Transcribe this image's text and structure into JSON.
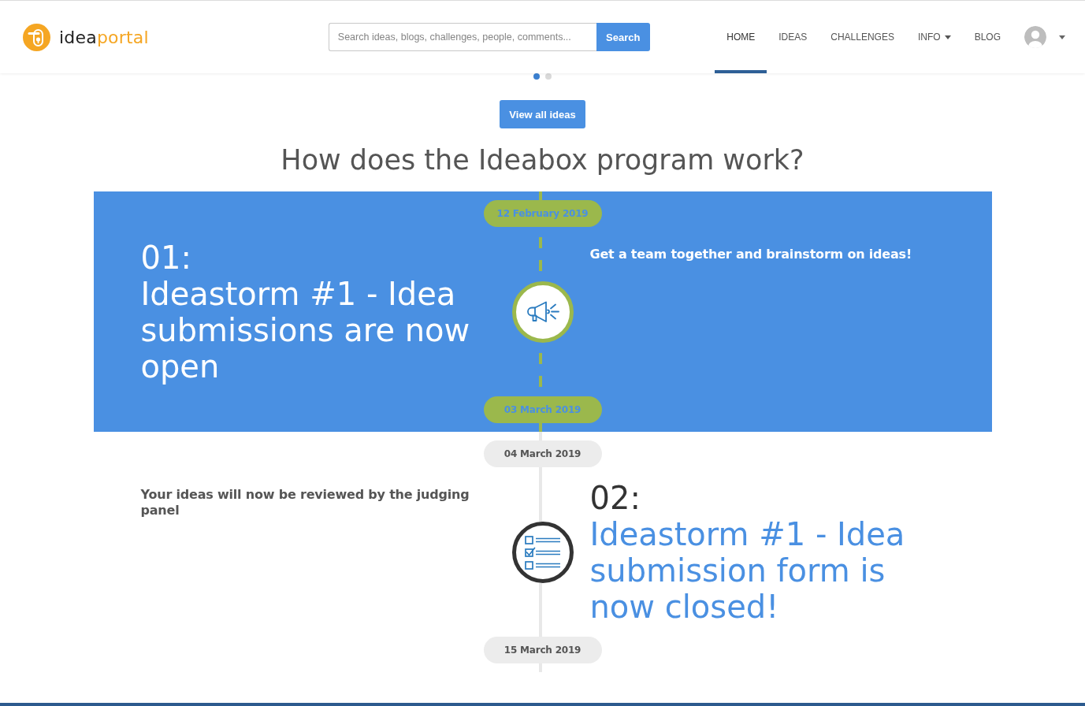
{
  "header": {
    "logo": {
      "parts": [
        {
          "text": "idea",
          "color": "#222222"
        },
        {
          "text": "portal",
          "color": "#f5a623"
        }
      ]
    },
    "search": {
      "placeholder": "Search ideas, blogs, challenges, people, comments...",
      "button": "Search"
    },
    "nav": [
      {
        "label": "HOME",
        "kind": "link",
        "selected": true
      },
      {
        "label": "IDEAS",
        "kind": "link",
        "selected": false
      },
      {
        "label": "CHALLENGES",
        "kind": "link",
        "selected": false
      },
      {
        "label": "INFO",
        "kind": "dropdown",
        "selected": false
      },
      {
        "label": "BLOG",
        "kind": "link",
        "selected": false
      }
    ]
  },
  "carousel": {
    "dots": [
      {
        "selected": true
      },
      {
        "selected": false
      }
    ]
  },
  "view_all_button": "View all ideas",
  "section_title": "How does the Ideabox program work?",
  "timeline": [
    {
      "kind": "submission",
      "active": true,
      "start_date": "12 February 2019",
      "end_date": "03 March 2019",
      "number": "01:",
      "title": "Ideastorm #1 - Idea submissions are now open",
      "description": "Get a team together and brainstorm on ideas!"
    },
    {
      "kind": "review",
      "active": false,
      "start_date": "04 March 2019",
      "end_date": "15 March 2019",
      "number": "02:",
      "title": "Ideastorm #1 - Idea submission form is now closed!",
      "description": "Your ideas will now be reviewed by the judging panel"
    }
  ]
}
